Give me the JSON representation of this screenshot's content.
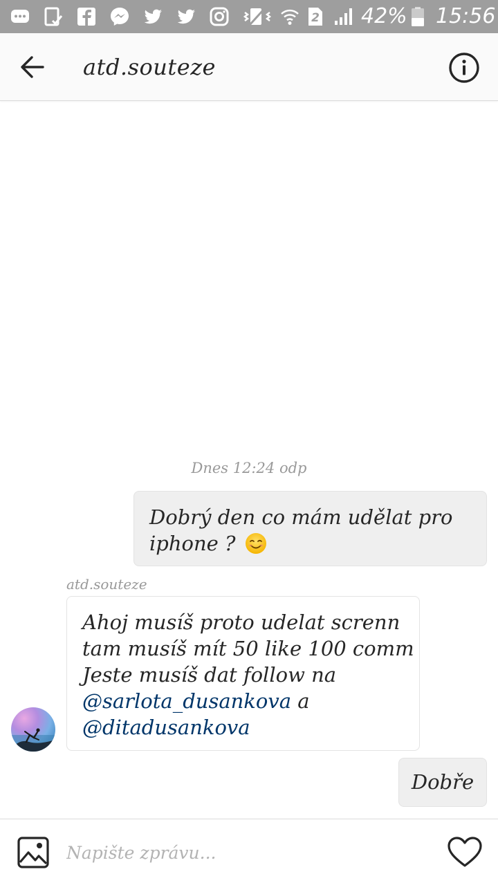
{
  "status_bar": {
    "battery_percent": "42%",
    "time": "15:56",
    "sim_badge": "2",
    "icons": [
      "chat-bubble-icon",
      "clipboard-check-icon",
      "facebook-icon",
      "messenger-icon",
      "twitter-icon",
      "twitter-icon",
      "instagram-icon",
      "vibrate-icon",
      "wifi-icon",
      "sim-icon",
      "signal-icon",
      "battery-icon"
    ]
  },
  "header": {
    "title": "atd.souteze",
    "back_icon": "arrow-left-icon",
    "info_icon": "info-circle-icon"
  },
  "conversation": {
    "timestamp": "Dnes 12:24 odp",
    "messages": [
      {
        "direction": "outgoing",
        "lines": [
          "Dobrý den co mám udělat pro",
          "iphone ?"
        ],
        "emoji": "smiling-face-icon"
      },
      {
        "direction": "incoming",
        "sender": "atd.souteze",
        "lines": [
          "Ahoj musíš proto udelat screnn",
          "tam musíš mít 50 like 100 comm",
          "Jeste musíš dat follow na"
        ],
        "mention1": "@sarlota_dusankova",
        "connector": "a",
        "mention2": "@ditadusankova"
      },
      {
        "direction": "outgoing",
        "text": "Dobře"
      }
    ]
  },
  "composer": {
    "placeholder": "Napište zprávu...",
    "gallery_icon": "image-icon",
    "like_icon": "heart-icon"
  },
  "colors": {
    "status_bar_bg": "#9e9e9e",
    "header_bg": "#fafafa",
    "outgoing_bubble": "#efefef",
    "mention_link": "#003569",
    "secondary_text": "#999999"
  }
}
